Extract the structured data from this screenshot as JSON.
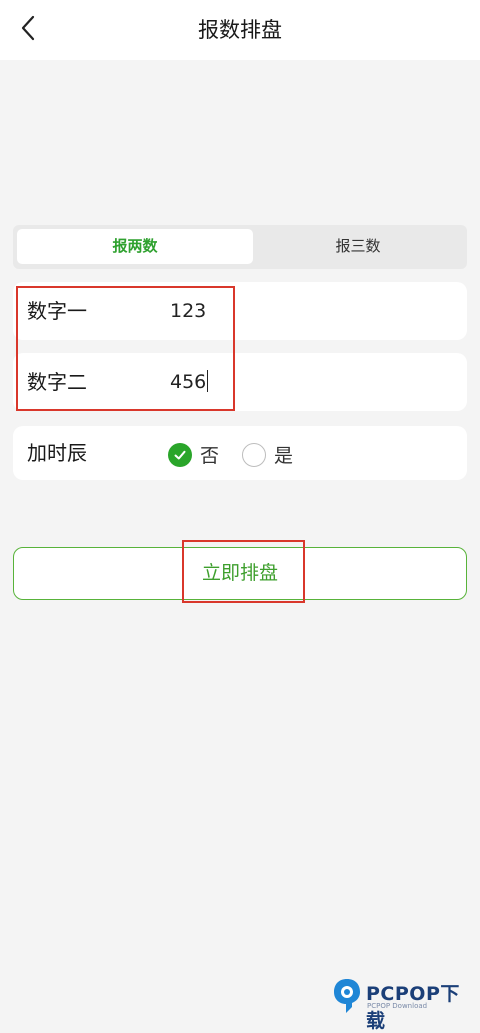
{
  "header": {
    "title": "报数排盘",
    "back_icon": "chevron-left-icon"
  },
  "tabs": [
    {
      "label": "报两数",
      "active": true
    },
    {
      "label": "报三数",
      "active": false
    }
  ],
  "fields": [
    {
      "label": "数字一",
      "value": "123"
    },
    {
      "label": "数字二",
      "value": "456"
    }
  ],
  "time_option": {
    "label": "加时辰",
    "options": [
      {
        "label": "否",
        "checked": true
      },
      {
        "label": "是",
        "checked": false
      }
    ]
  },
  "submit": {
    "label": "立即排盘"
  },
  "watermark": {
    "text": "PCPOP下载",
    "sub": "PCPOP Download"
  },
  "colors": {
    "accent": "#2fa12f",
    "annotation": "#d9372b",
    "background": "#f4f4f4"
  }
}
